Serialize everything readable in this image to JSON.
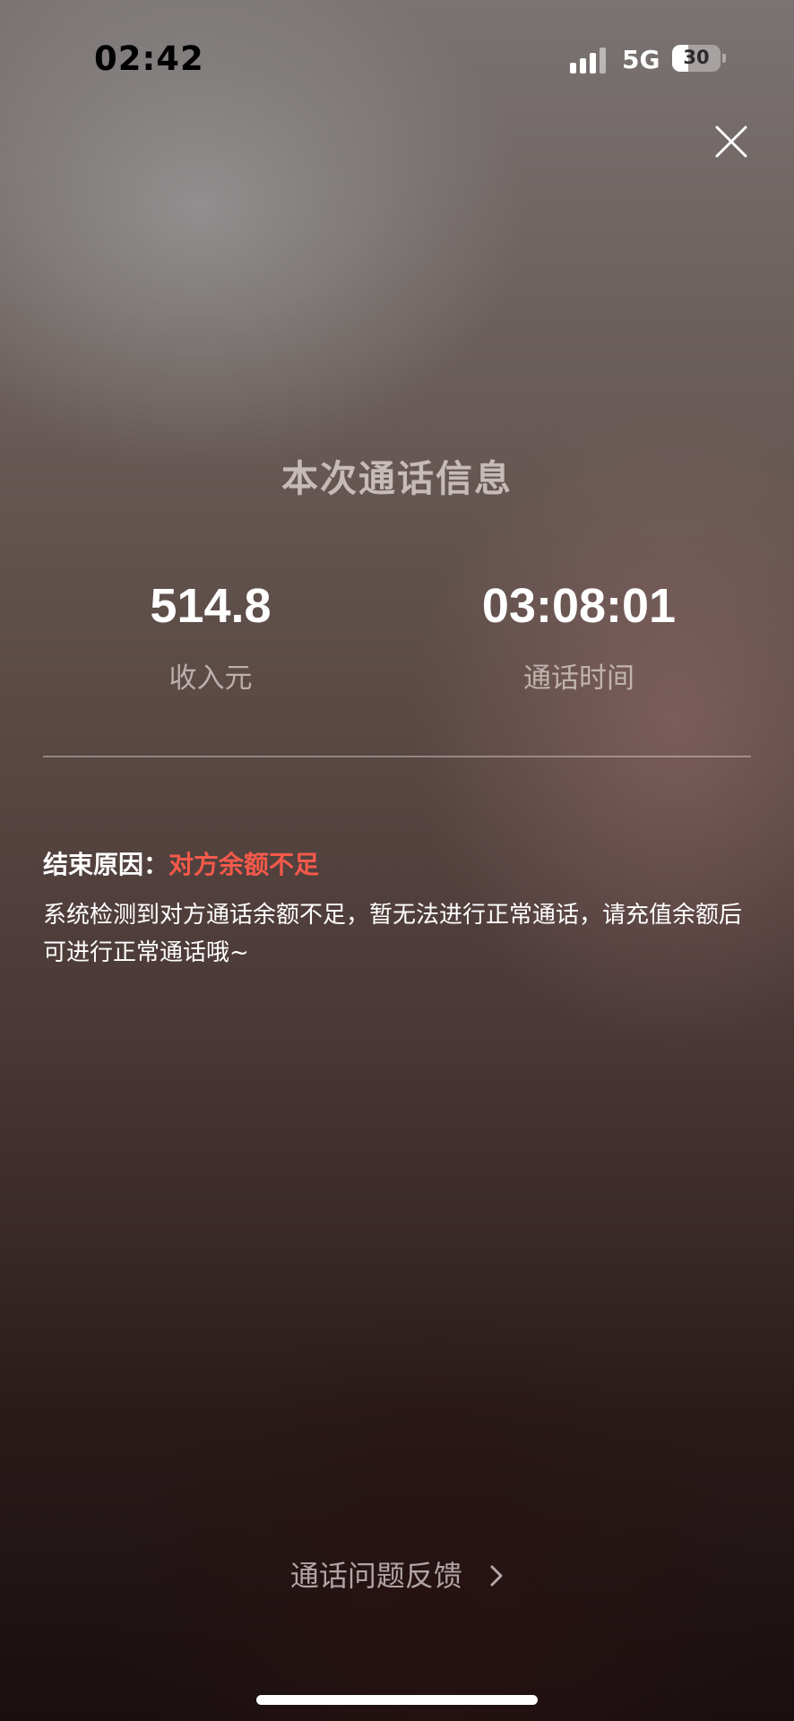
{
  "status_bar": {
    "time": "02:42",
    "network": "5G",
    "battery": "30"
  },
  "summary": {
    "title": "本次通话信息",
    "income_value": "514.8",
    "income_label": "收入元",
    "duration_value": "03:08:01",
    "duration_label": "通话时间"
  },
  "end": {
    "reason_label": "结束原因：",
    "reason_value": "对方余额不足",
    "description": "系统检测到对方通话余额不足，暂无法进行正常通话，请充值余额后可进行正常通话哦~"
  },
  "footer": {
    "feedback_label": "通话问题反馈"
  },
  "colors": {
    "reason_accent": "#f45a4a"
  }
}
